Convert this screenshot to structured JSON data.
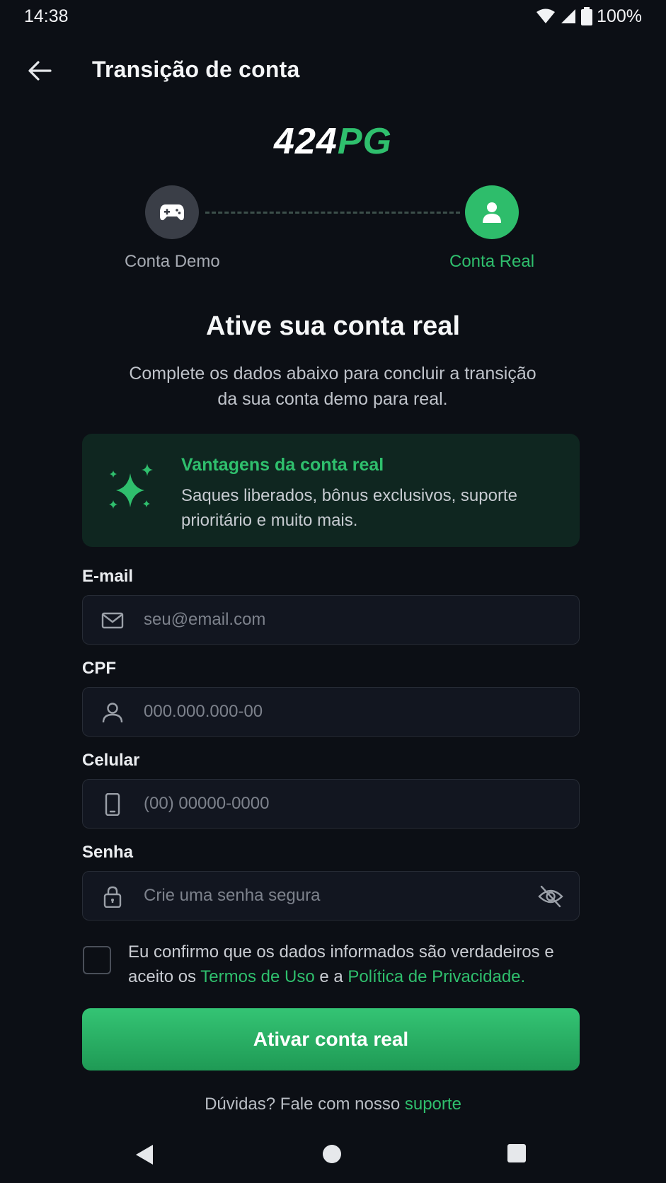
{
  "status_bar": {
    "time": "14:38",
    "battery": "100%"
  },
  "app_bar": {
    "title": "Transição de conta"
  },
  "logo": {
    "number": "424",
    "letters": "PG"
  },
  "stepper": {
    "demo_label": "Conta Demo",
    "real_label": "Conta Real"
  },
  "heading": "Ative sua conta real",
  "subtext": "Complete os dados abaixo para concluir a transição da sua conta demo para real.",
  "benefits": {
    "title": "Vantagens da conta real",
    "text": "Saques liberados, bônus exclusivos, suporte prioritário e muito mais."
  },
  "form": {
    "email": {
      "label": "E-mail",
      "placeholder": "seu@email.com"
    },
    "cpf": {
      "label": "CPF",
      "placeholder": "000.000.000-00"
    },
    "phone": {
      "label": "Celular",
      "placeholder": "(00) 00000-0000"
    },
    "password": {
      "label": "Senha",
      "placeholder": "Crie uma senha segura"
    }
  },
  "terms": {
    "prefix": "Eu confirmo que os dados informados são verdadeiros e aceito os ",
    "terms_link": "Termos de Uso",
    "middle": " e a ",
    "privacy_link": "Política de Privacidade."
  },
  "cta_label": "Ativar conta real",
  "help": {
    "prefix": "Dúvidas? Fale com nosso ",
    "link": "suporte"
  },
  "colors": {
    "accent": "#2fbf6d",
    "background": "#0c0f15",
    "benefits_bg": "#0f2620",
    "field_bg": "#121620"
  },
  "icons": {
    "back": "arrow-left-icon",
    "demo_step": "gamepad-icon",
    "real_step": "user-icon",
    "benefits": "sparkles-icon",
    "email": "mail-icon",
    "cpf": "user-outline-icon",
    "phone": "smartphone-icon",
    "password": "lock-icon",
    "toggle_password": "eye-off-icon"
  }
}
